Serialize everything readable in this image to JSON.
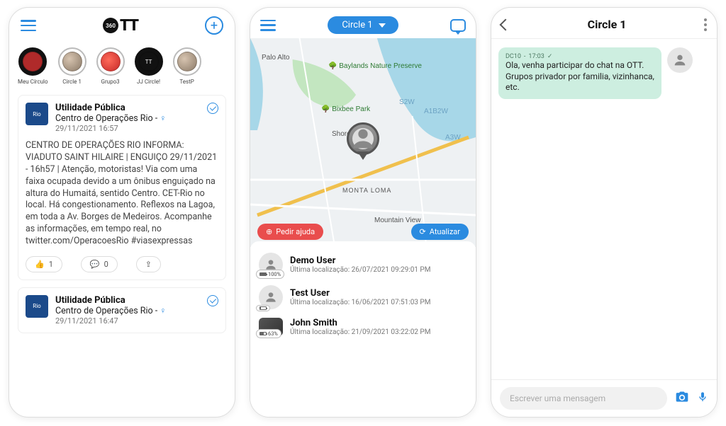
{
  "colors": {
    "accent": "#2b8be0",
    "danger": "#e94d4d",
    "chat_bubble": "#cdeee0"
  },
  "screen1": {
    "logo_small": "360",
    "logo_text": "TT",
    "stories": [
      {
        "label": "Meu Círculo"
      },
      {
        "label": "Circle 1"
      },
      {
        "label": "Grupo3"
      },
      {
        "label": "JJ Circle!"
      },
      {
        "label": "TestP"
      }
    ],
    "posts": [
      {
        "avatar_text": "Rio",
        "title_bold": "Utilidade Pública",
        "source": "Centro de Operações Rio - ",
        "timestamp": "29/11/2021 16:57",
        "body": "CENTRO DE OPERAÇÕES RIO INFORMA: VIADUTO SAINT HILAIRE | ENGUIÇO 29/11/2021 - 16h57 | Atenção, motoristas! Via com uma faixa ocupada devido a um ônibus enguiçado na altura do Humaitá, sentido Centro. CET-Rio no local. Há congestionamento. Reflexos na Lagoa, em toda a Av. Borges de Medeiros. Acompanhe as informações, em tempo real, no twitter.com/OperacoesRio #viasexpressas",
        "like_count": "1",
        "comment_count": "0"
      },
      {
        "avatar_text": "Rio",
        "title_bold": "Utilidade Pública",
        "source": "Centro de Operações Rio - ",
        "timestamp": "29/11/2021 16:47"
      }
    ]
  },
  "screen2": {
    "circle_label": "Circle 1",
    "help_button": "Pedir ajuda",
    "update_button": "Atualizar",
    "map_labels": {
      "palo_alto": "Palo Alto",
      "baylands": "Baylands Nature Preserve",
      "bixbee": "Bixbee Park",
      "shoreline": "Shoreline",
      "monta_loma": "MONTA LOMA",
      "mountain_view": "Mountain View",
      "a3w": "A3W",
      "a1b2w": "A1B2W",
      "s2w": "S2W"
    },
    "users": [
      {
        "name": "Demo User",
        "last_loc_prefix": "Última localização: ",
        "last_loc": "26/07/2021 09:29:01 PM",
        "battery": "100%"
      },
      {
        "name": "Test User",
        "last_loc_prefix": "Última localização: ",
        "last_loc": "16/06/2021 07:51:03 PM",
        "battery": ""
      },
      {
        "name": "John Smith",
        "last_loc_prefix": "Última localização: ",
        "last_loc": "21/09/2021 03:22:02 PM",
        "battery": "63%"
      }
    ]
  },
  "screen3": {
    "title": "Circle 1",
    "message": {
      "sender": "DC10",
      "time": "17:03",
      "text": "Ola, venha participar do chat na OTT. Grupos privador por familia, vizinhanca, etc."
    },
    "input_placeholder": "Escrever uma mensagem"
  }
}
